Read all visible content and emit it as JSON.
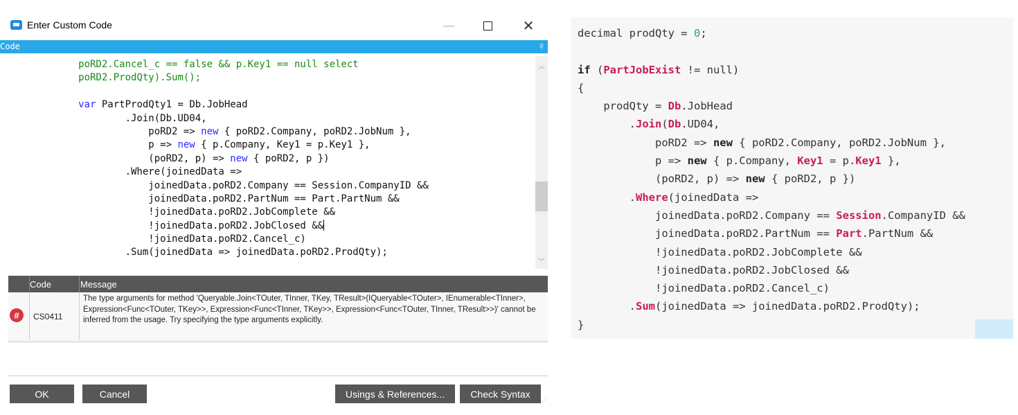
{
  "window": {
    "title": "Enter Custom Code",
    "minimize": "—",
    "close": "✕"
  },
  "code_panel": {
    "header": "Code",
    "pin": "ф"
  },
  "editor_lines": [
    {
      "indent": "            ",
      "text": "poRD2.Cancel_c == false && p.Key1 == null select",
      "color": "green"
    },
    {
      "indent": "            ",
      "text": "poRD2.ProdQty).Sum();",
      "color": "green"
    },
    {
      "indent": "",
      "text": "",
      "color": "dark"
    },
    {
      "indent": "            ",
      "text": "var PartProdQty1 = Db.JobHead",
      "color": "dark"
    },
    {
      "indent": "                    ",
      "text": ".Join(Db.UD04,",
      "color": "dark"
    },
    {
      "indent": "                        ",
      "text": "poRD2 => new { poRD2.Company, poRD2.JobNum },",
      "color": "dark"
    },
    {
      "indent": "                        ",
      "text": "p => new { p.Company, Key1 = p.Key1 },",
      "color": "dark"
    },
    {
      "indent": "                        ",
      "text": "(poRD2, p) => new { poRD2, p })",
      "color": "dark"
    },
    {
      "indent": "                    ",
      "text": ".Where(joinedData =>",
      "color": "dark"
    },
    {
      "indent": "                        ",
      "text": "joinedData.poRD2.Company == Session.CompanyID &&",
      "color": "dark"
    },
    {
      "indent": "                        ",
      "text": "joinedData.poRD2.PartNum == Part.PartNum &&",
      "color": "dark"
    },
    {
      "indent": "                        ",
      "text": "!joinedData.poRD2.JobComplete &&",
      "color": "dark"
    },
    {
      "indent": "                        ",
      "text": "!joinedData.poRD2.JobClosed &&",
      "color": "dark"
    },
    {
      "indent": "                        ",
      "text": "!joinedData.poRD2.Cancel_c)",
      "color": "dark"
    },
    {
      "indent": "                    ",
      "text": ".Sum(joinedData => joinedData.poRD2.ProdQty);",
      "color": "dark"
    }
  ],
  "errors": {
    "columns": [
      "Code",
      "Message"
    ],
    "rows": [
      {
        "icon": "#",
        "code": "CS0411",
        "message": "The type arguments for method 'Queryable.Join<TOuter, TInner, TKey, TResult>(IQueryable<TOuter>, IEnumerable<TInner>, Expression<Func<TOuter, TKey>>, Expression<Func<TInner, TKey>>, Expression<Func<TOuter, TInner, TResult>>)' cannot be inferred from the usage. Try specifying the type arguments explicitly."
      }
    ]
  },
  "buttons": {
    "ok": "OK",
    "cancel": "Cancel",
    "usings": "Usings & References...",
    "check": "Check Syntax"
  },
  "snippet_lines": [
    "decimal prodQty = 0;",
    "",
    "if (PartJobExist != null)",
    "{",
    "    prodQty = Db.JobHead",
    "        .Join(Db.UD04,",
    "            poRD2 => new { poRD2.Company, poRD2.JobNum },",
    "            p => new { p.Company, Key1 = p.Key1 },",
    "            (poRD2, p) => new { poRD2, p })",
    "        .Where(joinedData =>",
    "            joinedData.poRD2.Company == Session.CompanyID &&",
    "            joinedData.poRD2.PartNum == Part.PartNum &&",
    "            !joinedData.poRD2.JobComplete &&",
    "            !joinedData.poRD2.JobClosed &&",
    "            !joinedData.poRD2.Cancel_c)",
    "        .Sum(joinedData => joinedData.poRD2.ProdQty);",
    "}"
  ]
}
